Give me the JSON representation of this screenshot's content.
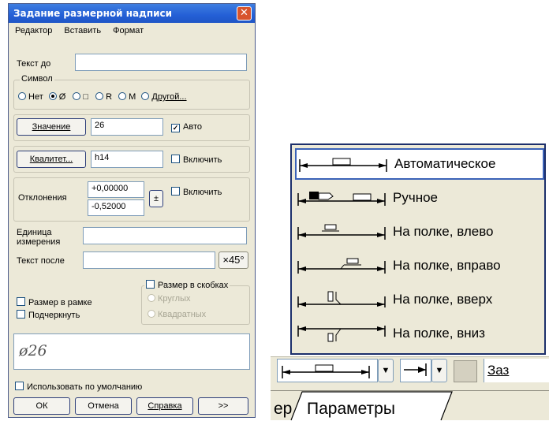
{
  "dialog": {
    "title": "Задание размерной надписи",
    "menu": [
      "Редактор",
      "Вставить",
      "Формат"
    ],
    "text_before_label": "Текст до",
    "text_before_value": "",
    "symbol_group": "Символ",
    "symbols": [
      {
        "label": "Нет",
        "selected": false
      },
      {
        "label": "Ø",
        "selected": true
      },
      {
        "label": "□",
        "selected": false
      },
      {
        "label": "R",
        "selected": false
      },
      {
        "label": "M",
        "selected": false
      },
      {
        "label": "Другой...",
        "selected": false
      }
    ],
    "value_button": "Значение",
    "value": "26",
    "auto_label": "Авто",
    "auto_checked": true,
    "qualitet_button": "Квалитет...",
    "qualitet_value": "h14",
    "include_label": "Включить",
    "deviations_label": "Отклонения",
    "dev_upper": "+0,00000",
    "dev_lower": "-0,52000",
    "pm_symbol": "±",
    "unit_label": "Единица измерения",
    "text_after_label": "Текст после",
    "degree_button": "×45°",
    "brackets_group": "Размер в скобках",
    "round_label": "Круглых",
    "square_label": "Квадратных",
    "frame_label": "Размер в рамке",
    "underline_label": "Подчеркнуть",
    "preview": "ø26",
    "default_label": "Использовать по умолчанию",
    "ok": "ОК",
    "cancel": "Отмена",
    "help": "Справка",
    "more": ">>"
  },
  "placement_menu": {
    "options": [
      {
        "label": "Автоматическое",
        "icon": "dim-auto-icon",
        "selected": true
      },
      {
        "label": "Ручное",
        "icon": "dim-manual-icon",
        "selected": false
      },
      {
        "label": "На полке, влево",
        "icon": "dim-shelf-left-icon",
        "selected": false
      },
      {
        "label": "На полке, вправо",
        "icon": "dim-shelf-right-icon",
        "selected": false
      },
      {
        "label": "На полке, вверх",
        "icon": "dim-shelf-up-icon",
        "selected": false
      },
      {
        "label": "На полке, вниз",
        "icon": "dim-shelf-down-icon",
        "selected": false
      }
    ],
    "toolbar_cut_label": "Заз",
    "tab_prev": "ер",
    "tab_current": "Параметры"
  }
}
